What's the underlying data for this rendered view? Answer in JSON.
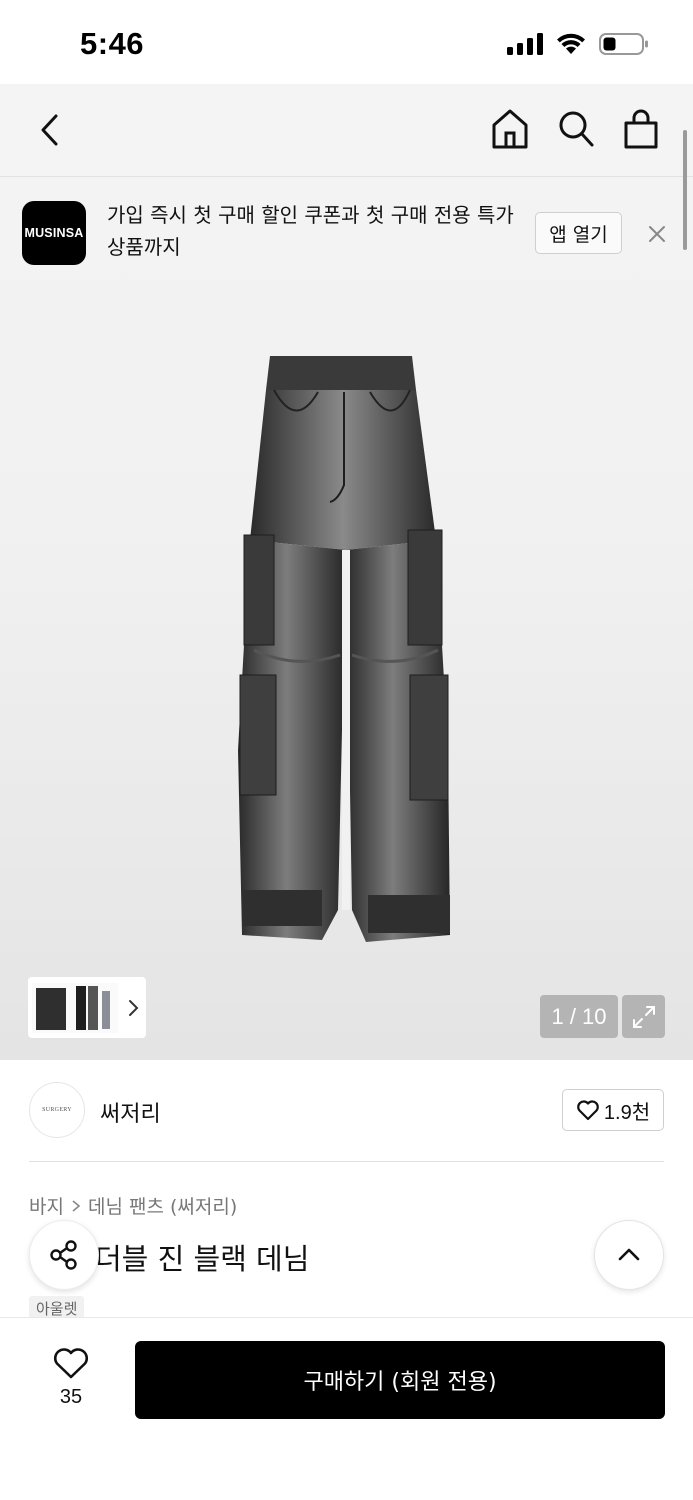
{
  "status_bar": {
    "time": "5:46"
  },
  "banner": {
    "logo_text": "MUSINSA",
    "message": "가입 즉시 첫 구매 할인 쿠폰과 첫 구매 전용 특가 상품까지",
    "open_app_label": "앱 열기"
  },
  "gallery": {
    "page_indicator": "1 / 10"
  },
  "brand": {
    "name": "써저리",
    "avatar_text": "SURGERY",
    "likes": "1.9천"
  },
  "product": {
    "breadcrumb": [
      "바지",
      "데님 팬츠 (써저리)"
    ],
    "title": "더블 진 블랙 데님",
    "badge": "아울렛"
  },
  "bottom_bar": {
    "wish_count": "35",
    "buy_label": "구매하기 (회원 전용)"
  },
  "colors": {
    "accent": "#000000",
    "background": "#ffffff",
    "gallery_bg": "#f1f1f1"
  }
}
